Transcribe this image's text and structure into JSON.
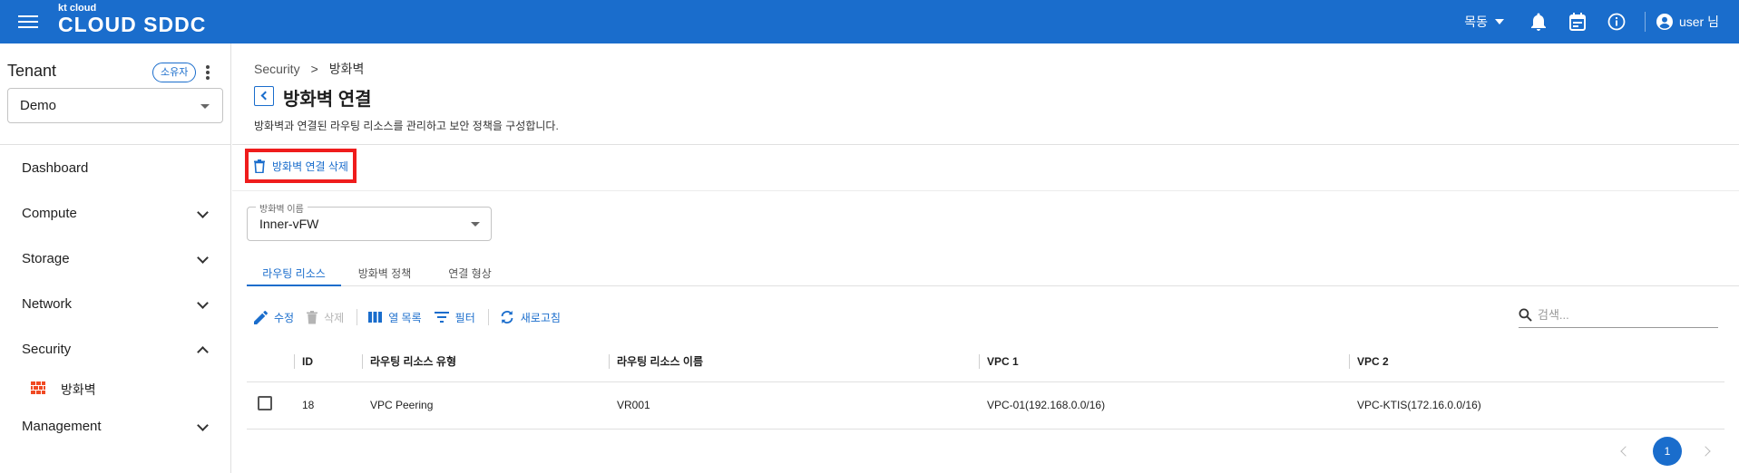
{
  "topbar": {
    "logo_small": "kt cloud",
    "logo_big": "CLOUD SDDC",
    "region": "목동",
    "user_label": "user 님",
    "icons": [
      "menu-icon",
      "bell-icon",
      "calendar-icon",
      "info-icon",
      "account-circle-icon"
    ]
  },
  "sidebar": {
    "tenant_title": "Tenant",
    "owner_badge": "소유자",
    "tenant_select_value": "Demo",
    "nav": [
      {
        "label": "Dashboard"
      },
      {
        "label": "Compute"
      },
      {
        "label": "Storage"
      },
      {
        "label": "Network"
      },
      {
        "label": "Security"
      },
      {
        "label": "Management"
      }
    ],
    "security_sub": {
      "label": "방화벽",
      "icon": "firewall-icon"
    }
  },
  "breadcrumb": {
    "root": "Security",
    "sep": ">",
    "current": "방화벽"
  },
  "page": {
    "title": "방화벽 연결",
    "description": "방화벽과 연결된 라우팅 리소스를 관리하고 보안 정책을 구성합니다.",
    "delete_connection_label": "방화벽 연결 삭제"
  },
  "firewall_select": {
    "legend": "방화벽 이름",
    "value": "Inner-vFW"
  },
  "tabs": [
    "라우팅 리소스",
    "방화벽 정책",
    "연결 형상"
  ],
  "toolbar": {
    "edit": "수정",
    "delete": "삭제",
    "columns": "열 목록",
    "filter": "필터",
    "refresh": "새로고침",
    "search_placeholder": "검색..."
  },
  "table": {
    "headers": [
      "ID",
      "라우팅 리소스 유형",
      "라우팅 리소스 이름",
      "VPC 1",
      "VPC 2"
    ],
    "rows": [
      {
        "id": "18",
        "type": "VPC Peering",
        "name": "VR001",
        "vpc1": "VPC-01(192.168.0.0/16)",
        "vpc2": "VPC-KTIS(172.16.0.0/16)"
      }
    ]
  },
  "pagination": {
    "current": "1"
  },
  "colors": {
    "brand": "#1a6dcc",
    "highlight": "#ef1c1c"
  }
}
